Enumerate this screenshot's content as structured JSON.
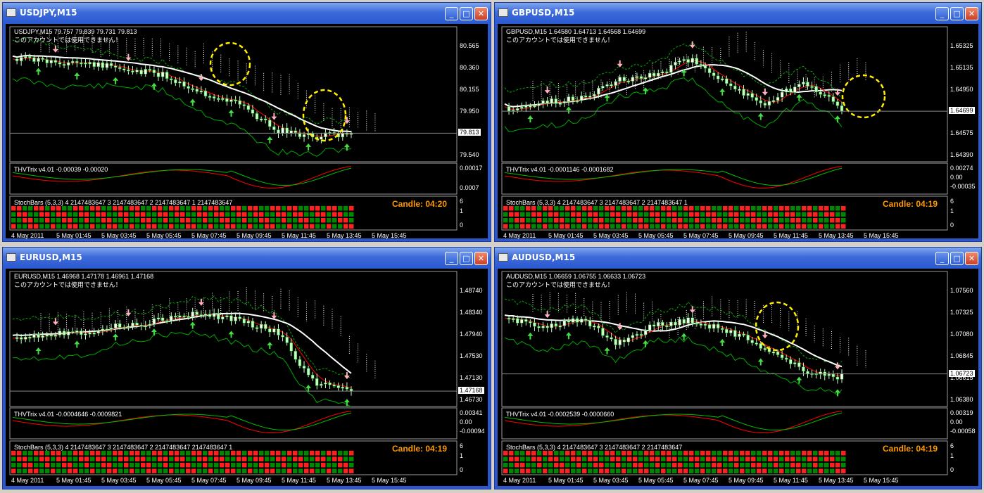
{
  "windows": [
    {
      "title": "USDJPY,M15",
      "header": "USDJPY,M15  79.757 79.839 79.731 79.813",
      "notice": "このアカウントでは使用できません！",
      "prices": [
        "80.565",
        "80.360",
        "80.155",
        "79.950",
        "79.745",
        "79.540"
      ],
      "current": "79.813",
      "trix": "THVTrix v4.01 -0.00039 -0.00020",
      "trix_scale": [
        "0.00017",
        "0.0007"
      ],
      "stoch": "StochBars (5,3,3) 4 2147483647 3 2147483647 2 2147483647 1 2147483647",
      "stoch_scale": [
        "6",
        "1",
        "0"
      ],
      "candle": "Candle:  04:20",
      "times": [
        "4 May 2011",
        "5 May 01:45",
        "5 May 03:45",
        "5 May 05:45",
        "5 May 07:45",
        "5 May 09:45",
        "5 May 11:45",
        "5 May 13:45",
        "5 May 15:45"
      ]
    },
    {
      "title": "GBPUSD,M15",
      "header": "GBPUSD,M15  1.64580 1.64713 1.64568 1.64699",
      "notice": "このアカウントでは使用できません！",
      "prices": [
        "1.65325",
        "1.65135",
        "1.64950",
        "1.64760",
        "1.64575",
        "1.64390"
      ],
      "current": "1.64699",
      "trix": "THVTrix v4.01 -0.0001146 -0.0001682",
      "trix_scale": [
        "0.00274",
        "0.00",
        "-0.00035"
      ],
      "stoch": "StochBars (5,3,3) 4 2147483647 3 2147483647 2 2147483647 1",
      "stoch_scale": [
        "6",
        "1",
        "0"
      ],
      "candle": "Candle:  04:19",
      "times": [
        "4 May 2011",
        "5 May 01:45",
        "5 May 03:45",
        "5 May 05:45",
        "5 May 07:45",
        "5 May 09:45",
        "5 May 11:45",
        "5 May 13:45",
        "5 May 15:45"
      ]
    },
    {
      "title": "EURUSD,M15",
      "header": "EURUSD,M15  1.46968 1.47178 1.46961 1.47168",
      "notice": "このアカウントでは使用できません！",
      "prices": [
        "1.48740",
        "1.48340",
        "1.47940",
        "1.47530",
        "1.47130",
        "1.46730"
      ],
      "current": "1.47168",
      "trix": "THVTrix v4.01 -0.0004646 -0.0009821",
      "trix_scale": [
        "0.00341",
        "0.00",
        "-0.00094"
      ],
      "stoch": "StochBars (5,3,3) 4 2147483647 3 2147483647 2 2147483647 2147483647 1",
      "stoch_scale": [
        "6",
        "1",
        "0"
      ],
      "candle": "Candle:  04:19",
      "times": [
        "4 May 2011",
        "5 May 01:45",
        "5 May 03:45",
        "5 May 05:45",
        "5 May 07:45",
        "5 May 09:45",
        "5 May 11:45",
        "5 May 13:45",
        "5 May 15:45"
      ]
    },
    {
      "title": "AUDUSD,M15",
      "header": "AUDUSD,M15  1.06659 1.06755 1.06633 1.06723",
      "notice": "このアカウントでは使用できません！",
      "prices": [
        "1.07560",
        "1.07325",
        "1.07080",
        "1.06845",
        "1.06615",
        "1.06380"
      ],
      "current": "1.06723",
      "trix": "THVTrix v4.01 -0.0002539 -0.0000660",
      "trix_scale": [
        "0.00319",
        "0.00",
        "-0.00058"
      ],
      "stoch": "StochBars (5,3,3) 4 2147483647 3 2147483647 2 2147483647",
      "stoch_scale": [
        "6",
        "1",
        "0"
      ],
      "candle": "Candle:  04:19",
      "times": [
        "4 May 2011",
        "5 May 01:45",
        "5 May 03:45",
        "5 May 05:45",
        "5 May 07:45",
        "5 May 09:45",
        "5 May 11:45",
        "5 May 13:45",
        "5 May 15:45"
      ]
    }
  ],
  "icons": {
    "minimize": "minimize-icon",
    "maximize": "maximize-icon",
    "close": "close-icon"
  },
  "colors": {
    "title_bar": "#2b59d0",
    "candle_up": "#ffffff",
    "candle_body": "#c8ffc8",
    "ma_red": "#ff0000",
    "ma_white": "#ffffff",
    "cloud": "#ffffff",
    "green_line": "#00c000",
    "yellow_circle": "#ffee00",
    "stoch_red": "#ff0000",
    "stoch_green": "#008800",
    "candle_timer": "#ff9a00"
  }
}
